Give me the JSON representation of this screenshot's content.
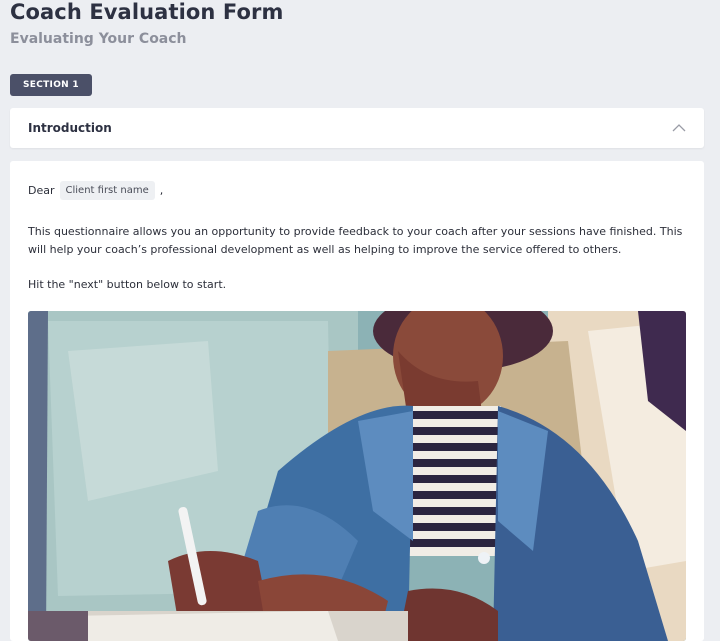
{
  "header": {
    "title": "Coach Evaluation Form",
    "subtitle": "Evaluating Your Coach"
  },
  "section": {
    "badge": "SECTION 1",
    "accordion_title": "Introduction",
    "chevron": "chevron-up-icon"
  },
  "content": {
    "greeting_prefix": "Dear",
    "merge_tag": "Client first name",
    "greeting_suffix": ",",
    "intro_text": "This questionnaire allows you an opportunity to provide feedback to your coach after your sessions have finished. This will help your coach’s professional development as well as helping to improve the service offered to others.",
    "start_text": "Hit the \"next\" button below to start."
  },
  "colors": {
    "page_bg": "#eceef2",
    "badge_bg": "#4b5068",
    "title": "#2d3142",
    "subtitle": "#8c8f9b",
    "card_bg": "#ffffff"
  }
}
